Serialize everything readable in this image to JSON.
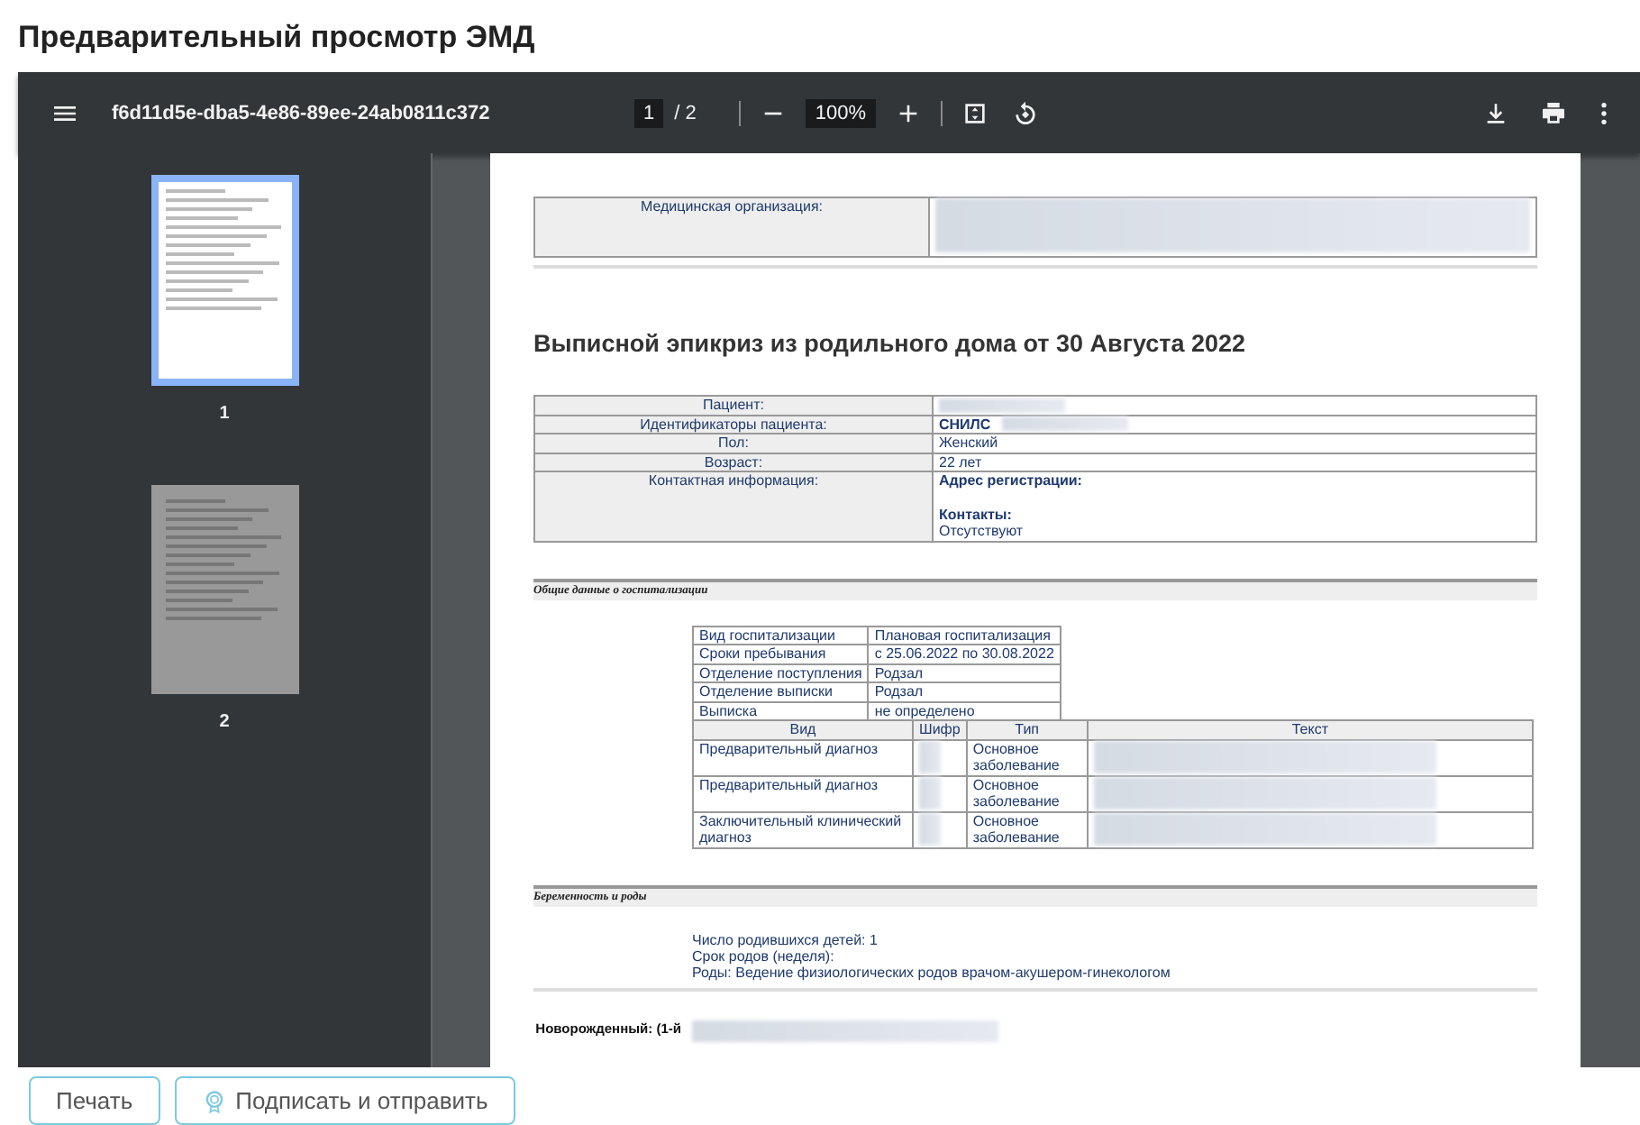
{
  "title": "Предварительный просмотр ЭМД",
  "viewer": {
    "file_name": "f6d11d5e-dba5-4e86-89ee-24ab0811c372",
    "page_current": "1",
    "page_total": "/ 2",
    "zoom": "100%",
    "thumbnails": [
      {
        "label": "1",
        "selected": true
      },
      {
        "label": "2",
        "selected": false
      }
    ]
  },
  "document": {
    "organization": {
      "label": "Медицинская организация:",
      "value_hidden": true
    },
    "heading": "Выписной эпикриз из родильного дома от 30 Августа 2022",
    "patient_rows": [
      {
        "label": "Пациент:",
        "parts": [],
        "value_hidden": true
      },
      {
        "label": "Идентификаторы пациента:",
        "parts": [
          {
            "text": "СНИЛС",
            "kind": "heading"
          }
        ],
        "value_hidden": true
      },
      {
        "label": "Пол:",
        "parts": [
          {
            "text": "Женский",
            "kind": "value"
          }
        ]
      },
      {
        "label": "Возраст:",
        "parts": [
          {
            "text": "22 лет",
            "kind": "value"
          }
        ]
      },
      {
        "label": "Контактная информация:",
        "parts": [
          {
            "text": "Адрес регистрации:",
            "kind": "heading"
          },
          {
            "text": "Контакты:",
            "kind": "heading"
          },
          {
            "text": "Отсутствуют",
            "kind": "value"
          }
        ]
      }
    ],
    "hospital_section": "Общие данные о госпитализации",
    "hospital_rows": [
      [
        "Вид госпитализации",
        "Плановая госпитализация"
      ],
      [
        "Сроки пребывания",
        "с 25.06.2022 по 30.08.2022"
      ],
      [
        "Отделение поступления",
        "Родзал"
      ],
      [
        "Отделение выписки",
        "Родзал"
      ],
      [
        "Выписка",
        "не определено"
      ]
    ],
    "diagnosis_columns": [
      "Вид",
      "Шифр",
      "Тип",
      "Текст"
    ],
    "diagnosis_rows": [
      {
        "diagnosis": "Предварительный диагноз",
        "type": "Основное заболевание"
      },
      {
        "diagnosis": "Предварительный диагноз",
        "type": "Основное заболевание"
      },
      {
        "diagnosis": "Заключительный клинический диагноз",
        "type": "Основное заболевание"
      }
    ],
    "pregnancy_section": "Беременность и роды",
    "pregnancy_lines": [
      "Число родившихся детей: 1",
      "Срок родов (неделя):",
      "Роды: Ведение физиологических родов врачом-акушером-гинекологом"
    ],
    "newborn_label": "Новорожденный: (1-й"
  },
  "buttons": [
    {
      "label": "Печать"
    },
    {
      "label": "Подписать и отправить"
    }
  ]
}
